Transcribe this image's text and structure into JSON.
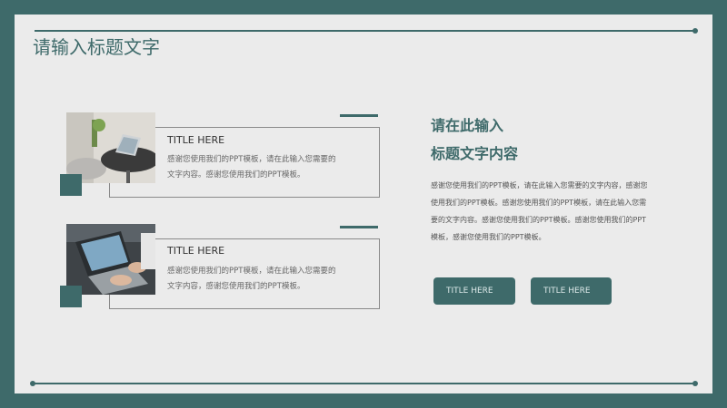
{
  "page": {
    "title": "请输入标题文字"
  },
  "cards": [
    {
      "title": "TITLE HERE",
      "body_line1": "感谢您使用我们的PPT模板，请在此输入您需要的",
      "body_line2": "文字内容。感谢您使用我们的PPT模板。",
      "photo": "laptop-on-table-photo"
    },
    {
      "title": "TITLE HERE",
      "body_line1": "感谢您使用我们的PPT模板，请在此输入您需要的",
      "body_line2": "文字内容，感谢您使用我们的PPT模板。",
      "photo": "typing-on-laptop-photo"
    }
  ],
  "right": {
    "heading_line1": "请在此输入",
    "heading_line2": "标题文字内容",
    "body_lines": [
      "感谢您使用我们的PPT模板，请在此输入您需要的文字内容，感谢您",
      "使用我们的PPT模板。感谢您使用我们的PPT模板，请在此输入您需",
      "要的文字内容。感谢您使用我们的PPT模板。感谢您使用我们的PPT",
      "模板，感谢您使用我们的PPT模板。"
    ]
  },
  "buttons": [
    {
      "label": "TITLE HERE"
    },
    {
      "label": "TITLE HERE"
    }
  ],
  "colors": {
    "accent": "#3e6a6a",
    "background": "#ebebeb"
  }
}
